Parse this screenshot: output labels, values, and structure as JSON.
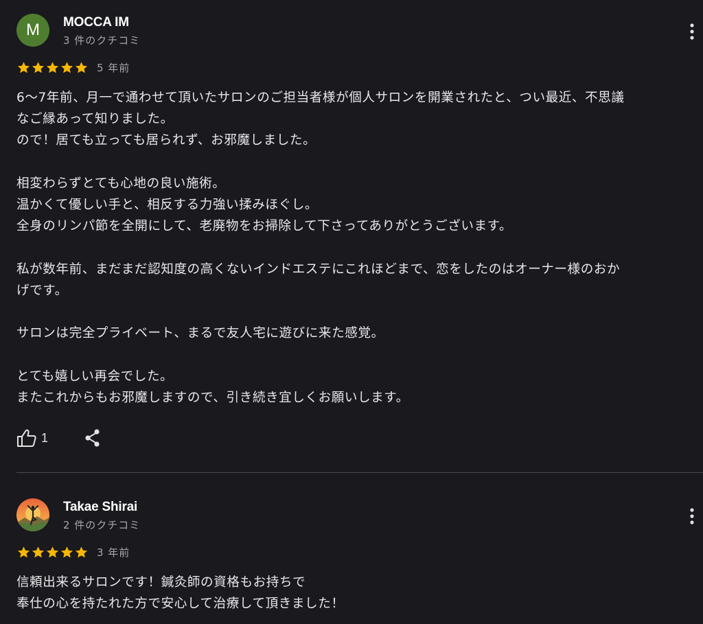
{
  "reviews": [
    {
      "author": "MOCCA IM",
      "avatar_letter": "M",
      "avatar_color": "#4f7d2f",
      "review_count": "3 件のクチコミ",
      "rating": 5,
      "time_ago": "5 年前",
      "lines": [
        "6〜7年前、月一で通わせて頂いたサロンのご担当者様が個人サロンを開業されたと、つい最近、不思議",
        "なご縁あって知りました。",
        "ので！居ても立っても居られず、お邪魔しました。",
        "",
        "相変わらずとても心地の良い施術。",
        "温かくて優しい手と、相反する力強い揉みほぐし。",
        "全身のリンパ節を全開にして、老廃物をお掃除して下さってありがとうございます。",
        "",
        "私が数年前、まだまだ認知度の高くないインドエステにこれほどまで、恋をしたのはオーナー様のおか",
        "げです。",
        "",
        "サロンは完全プライベート、まるで友人宅に遊びに来た感覚。",
        "",
        "とても嬉しい再会でした。",
        "またこれからもお邪魔しますので、引き続き宜しくお願いします。"
      ],
      "likes": "1",
      "icons": {
        "like": "thumbs-up-icon",
        "share": "share-icon",
        "more": "more-vert-icon"
      }
    },
    {
      "author": "Takae Shirai",
      "avatar_type": "yoga-sunset-image",
      "review_count": "2 件のクチコミ",
      "rating": 5,
      "time_ago": "3 年前",
      "lines": [
        "信頼出来るサロンです！鍼灸師の資格もお持ちで",
        "奉仕の心を持たれた方で安心して治療して頂きました！"
      ],
      "icons": {
        "more": "more-vert-icon"
      }
    }
  ],
  "colors": {
    "background": "#1a191e",
    "star": "#f6b704",
    "secondary_text": "#a8a8ab",
    "divider": "#4a4a4e"
  }
}
